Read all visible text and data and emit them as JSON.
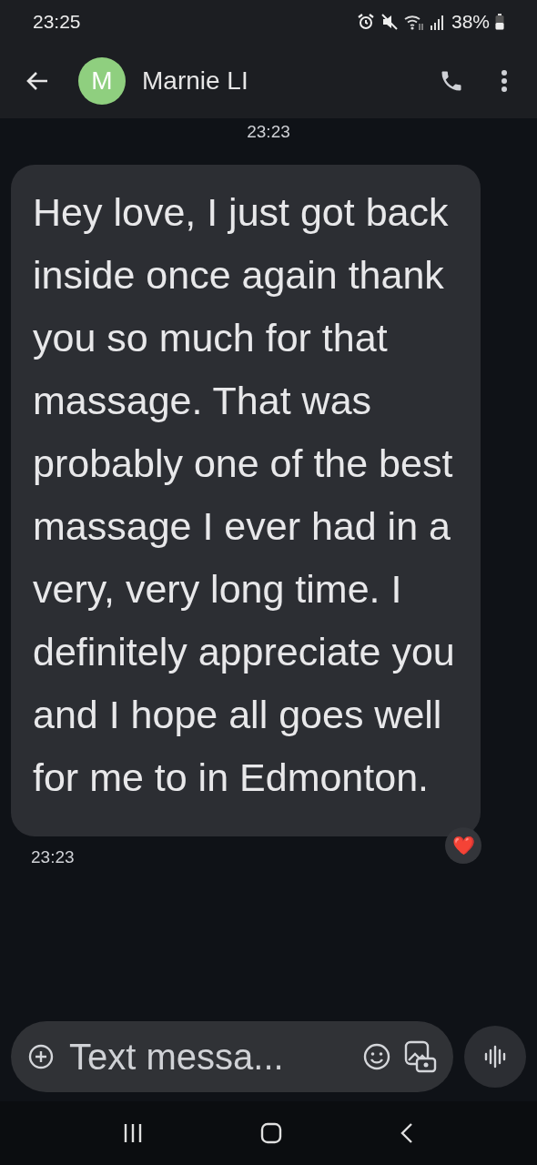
{
  "status_bar": {
    "time": "23:25",
    "battery": "38%"
  },
  "header": {
    "avatar_letter": "M",
    "contact": "Marnie LI"
  },
  "messages": [
    {
      "timestamp_above": "23:23",
      "text": "Hey love, I just got back inside once again thank you so much for that massage. That was probably one of the best massage I ever had in a very, very long time. I definitely appreciate you and I hope all goes well for me to in Edmonton.",
      "reaction": "❤️",
      "timestamp_below": "23:23"
    }
  ],
  "composer": {
    "placeholder": "Text messa..."
  }
}
